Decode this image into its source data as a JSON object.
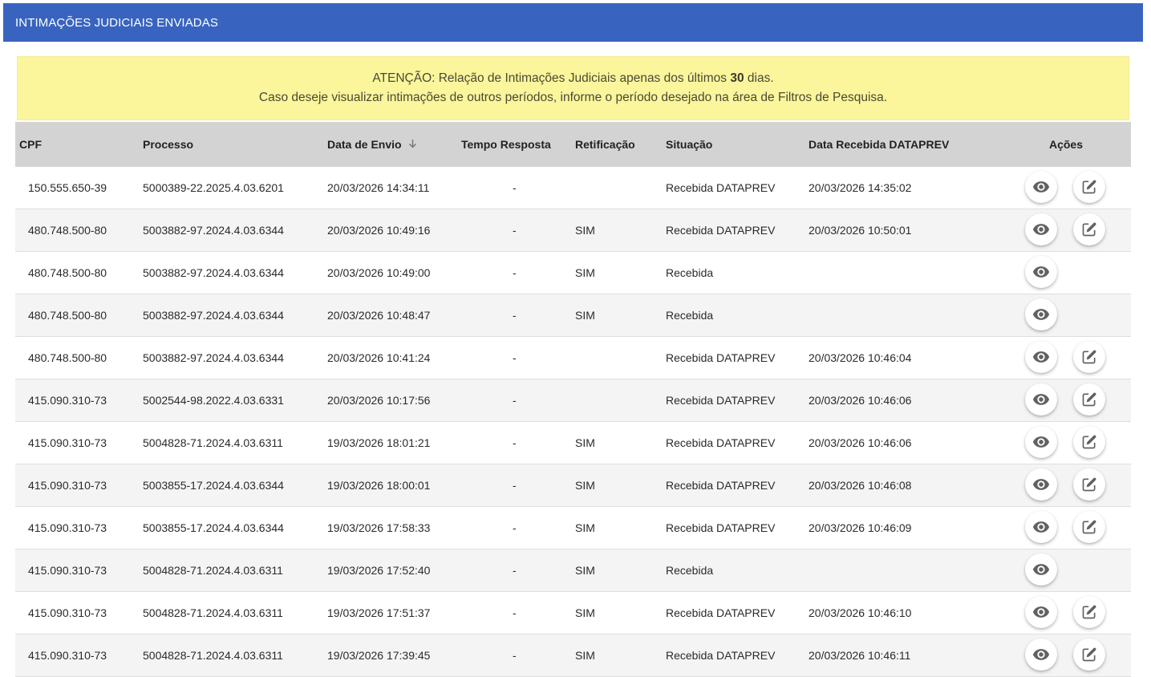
{
  "header": {
    "title": "INTIMAÇÕES JUDICIAIS ENVIADAS"
  },
  "alert": {
    "line1_prefix": "ATENÇÃO: Relação de Intimações Judiciais apenas dos últimos",
    "line1_days": "30",
    "line1_suffix": "dias.",
    "line2": "Caso deseje visualizar intimações de outros períodos, informe o período desejado na área de Filtros de Pesquisa."
  },
  "table": {
    "columns": {
      "cpf": "CPF",
      "processo": "Processo",
      "data_envio": "Data de Envio",
      "tempo_resposta": "Tempo Resposta",
      "retificacao": "Retificação",
      "situacao": "Situação",
      "data_recebida": "Data Recebida DATAPREV",
      "acoes": "Ações"
    },
    "rows": [
      {
        "cpf": "150.555.650-39",
        "processo": "5000389-22.2025.4.03.6201",
        "data_envio": "20/03/2026 14:34:11",
        "tempo_resposta": "-",
        "retificacao": "",
        "situacao": "Recebida DATAPREV",
        "data_recebida": "20/03/2026 14:35:02",
        "edit": true
      },
      {
        "cpf": "480.748.500-80",
        "processo": "5003882-97.2024.4.03.6344",
        "data_envio": "20/03/2026 10:49:16",
        "tempo_resposta": "-",
        "retificacao": "SIM",
        "situacao": "Recebida DATAPREV",
        "data_recebida": "20/03/2026 10:50:01",
        "edit": true
      },
      {
        "cpf": "480.748.500-80",
        "processo": "5003882-97.2024.4.03.6344",
        "data_envio": "20/03/2026 10:49:00",
        "tempo_resposta": "-",
        "retificacao": "SIM",
        "situacao": "Recebida",
        "data_recebida": "",
        "edit": false
      },
      {
        "cpf": "480.748.500-80",
        "processo": "5003882-97.2024.4.03.6344",
        "data_envio": "20/03/2026 10:48:47",
        "tempo_resposta": "-",
        "retificacao": "SIM",
        "situacao": "Recebida",
        "data_recebida": "",
        "edit": false
      },
      {
        "cpf": "480.748.500-80",
        "processo": "5003882-97.2024.4.03.6344",
        "data_envio": "20/03/2026 10:41:24",
        "tempo_resposta": "-",
        "retificacao": "",
        "situacao": "Recebida DATAPREV",
        "data_recebida": "20/03/2026 10:46:04",
        "edit": true
      },
      {
        "cpf": "415.090.310-73",
        "processo": "5002544-98.2022.4.03.6331",
        "data_envio": "20/03/2026 10:17:56",
        "tempo_resposta": "-",
        "retificacao": "",
        "situacao": "Recebida DATAPREV",
        "data_recebida": "20/03/2026 10:46:06",
        "edit": true
      },
      {
        "cpf": "415.090.310-73",
        "processo": "5004828-71.2024.4.03.6311",
        "data_envio": "19/03/2026 18:01:21",
        "tempo_resposta": "-",
        "retificacao": "SIM",
        "situacao": "Recebida DATAPREV",
        "data_recebida": "20/03/2026 10:46:06",
        "edit": true
      },
      {
        "cpf": "415.090.310-73",
        "processo": "5003855-17.2024.4.03.6344",
        "data_envio": "19/03/2026 18:00:01",
        "tempo_resposta": "-",
        "retificacao": "SIM",
        "situacao": "Recebida DATAPREV",
        "data_recebida": "20/03/2026 10:46:08",
        "edit": true
      },
      {
        "cpf": "415.090.310-73",
        "processo": "5003855-17.2024.4.03.6344",
        "data_envio": "19/03/2026 17:58:33",
        "tempo_resposta": "-",
        "retificacao": "SIM",
        "situacao": "Recebida DATAPREV",
        "data_recebida": "20/03/2026 10:46:09",
        "edit": true
      },
      {
        "cpf": "415.090.310-73",
        "processo": "5004828-71.2024.4.03.6311",
        "data_envio": "19/03/2026 17:52:40",
        "tempo_resposta": "-",
        "retificacao": "SIM",
        "situacao": "Recebida",
        "data_recebida": "",
        "edit": false
      },
      {
        "cpf": "415.090.310-73",
        "processo": "5004828-71.2024.4.03.6311",
        "data_envio": "19/03/2026 17:51:37",
        "tempo_resposta": "-",
        "retificacao": "SIM",
        "situacao": "Recebida DATAPREV",
        "data_recebida": "20/03/2026 10:46:10",
        "edit": true
      },
      {
        "cpf": "415.090.310-73",
        "processo": "5004828-71.2024.4.03.6311",
        "data_envio": "19/03/2026 17:39:45",
        "tempo_resposta": "-",
        "retificacao": "SIM",
        "situacao": "Recebida DATAPREV",
        "data_recebida": "20/03/2026 10:46:11",
        "edit": true
      }
    ]
  },
  "icons": {
    "view": "eye-icon",
    "edit": "edit-icon",
    "sort": "arrow-down-icon"
  },
  "colors": {
    "header_bg": "#3864c0",
    "alert_bg": "#fbf59c",
    "table_header_bg": "#d3d3d3"
  }
}
